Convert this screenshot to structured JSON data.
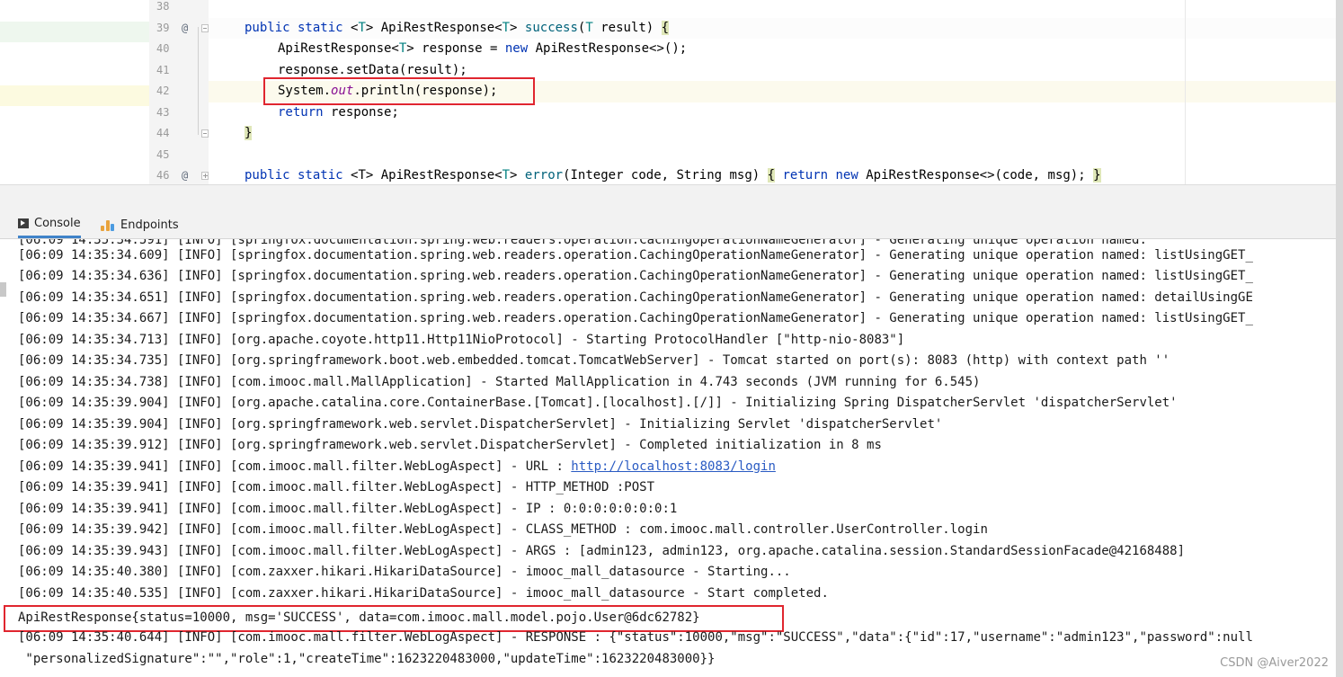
{
  "editor": {
    "lines": [
      {
        "num": "38",
        "ann": "",
        "fold": ""
      },
      {
        "num": "39",
        "ann": "@",
        "fold": "minus"
      },
      {
        "num": "40",
        "ann": "",
        "fold": ""
      },
      {
        "num": "41",
        "ann": "",
        "fold": ""
      },
      {
        "num": "42",
        "ann": "",
        "fold": ""
      },
      {
        "num": "43",
        "ann": "",
        "fold": ""
      },
      {
        "num": "44",
        "ann": "",
        "fold": "minus"
      },
      {
        "num": "45",
        "ann": "",
        "fold": ""
      },
      {
        "num": "46",
        "ann": "@",
        "fold": "plus"
      }
    ],
    "code": {
      "l39": {
        "a": "public static ",
        "b": "<",
        "c": "T",
        "d": "> ApiRestResponse<",
        "e": "T",
        "f": "> ",
        "g": "success",
        "h": "(",
        "i": "T",
        "j": " result) ",
        "k": "{"
      },
      "l40": {
        "a": "ApiRestResponse<",
        "b": "T",
        "c": "> response = ",
        "d": "new",
        "e": " ApiRestResponse<>();"
      },
      "l41": {
        "a": "response.setData(result);"
      },
      "l42": {
        "a": "System.",
        "b": "out",
        "c": ".println(response);"
      },
      "l43": {
        "a": "return",
        "b": " response;"
      },
      "l44": {
        "a": "}"
      },
      "l46": {
        "a": "public static ",
        "b": "<T>",
        "c": " ApiRestResponse<",
        "d": "T",
        "e": "> ",
        "f": "error",
        "g": "(Integer code, String msg) ",
        "h": "{",
        "i": " return new",
        "j": " ApiRestResponse<>(code, msg); ",
        "k": "}"
      }
    }
  },
  "toolwindow": {
    "tabs": [
      {
        "label": "Console",
        "icon": "console-icon"
      },
      {
        "label": "Endpoints",
        "icon": "endpoints-icon"
      }
    ]
  },
  "console": {
    "lines": [
      "[06:09 14:35:34.609] [INFO] [springfox.documentation.spring.web.readers.operation.CachingOperationNameGenerator] - Generating unique operation named: listUsingGET_",
      "[06:09 14:35:34.636] [INFO] [springfox.documentation.spring.web.readers.operation.CachingOperationNameGenerator] - Generating unique operation named: listUsingGET_",
      "[06:09 14:35:34.651] [INFO] [springfox.documentation.spring.web.readers.operation.CachingOperationNameGenerator] - Generating unique operation named: detailUsingGE",
      "[06:09 14:35:34.667] [INFO] [springfox.documentation.spring.web.readers.operation.CachingOperationNameGenerator] - Generating unique operation named: listUsingGET_",
      "[06:09 14:35:34.713] [INFO] [org.apache.coyote.http11.Http11NioProtocol] - Starting ProtocolHandler [\"http-nio-8083\"]",
      "[06:09 14:35:34.735] [INFO] [org.springframework.boot.web.embedded.tomcat.TomcatWebServer] - Tomcat started on port(s): 8083 (http) with context path ''",
      "[06:09 14:35:34.738] [INFO] [com.imooc.mall.MallApplication] - Started MallApplication in 4.743 seconds (JVM running for 6.545)",
      "[06:09 14:35:39.904] [INFO] [org.apache.catalina.core.ContainerBase.[Tomcat].[localhost].[/]] - Initializing Spring DispatcherServlet 'dispatcherServlet'",
      "[06:09 14:35:39.904] [INFO] [org.springframework.web.servlet.DispatcherServlet] - Initializing Servlet 'dispatcherServlet'",
      "[06:09 14:35:39.912] [INFO] [org.springframework.web.servlet.DispatcherServlet] - Completed initialization in 8 ms"
    ],
    "url_line": {
      "prefix": "[06:09 14:35:39.941] [INFO] [com.imooc.mall.filter.WebLogAspect] - URL : ",
      "link": "http://localhost:8083/login"
    },
    "lines2": [
      "[06:09 14:35:39.941] [INFO] [com.imooc.mall.filter.WebLogAspect] - HTTP_METHOD :POST",
      "[06:09 14:35:39.941] [INFO] [com.imooc.mall.filter.WebLogAspect] - IP : 0:0:0:0:0:0:0:1",
      "[06:09 14:35:39.942] [INFO] [com.imooc.mall.filter.WebLogAspect] - CLASS_METHOD : com.imooc.mall.controller.UserController.login",
      "[06:09 14:35:39.943] [INFO] [com.imooc.mall.filter.WebLogAspect] - ARGS : [admin123, admin123, org.apache.catalina.session.StandardSessionFacade@42168488]",
      "[06:09 14:35:40.380] [INFO] [com.zaxxer.hikari.HikariDataSource] - imooc_mall_datasource - Starting...",
      "[06:09 14:35:40.535] [INFO] [com.zaxxer.hikari.HikariDataSource] - imooc_mall_datasource - Start completed.",
      "ApiRestResponse{status=10000, msg='SUCCESS', data=com.imooc.mall.model.pojo.User@6dc62782}",
      "[06:09 14:35:40.644] [INFO] [com.imooc.mall.filter.WebLogAspect] - RESPONSE : {\"status\":10000,\"msg\":\"SUCCESS\",\"data\":{\"id\":17,\"username\":\"admin123\",\"password\":null",
      " \"personalizedSignature\":\"\",\"role\":1,\"createTime\":1623220483000,\"updateTime\":1623220483000}}"
    ]
  },
  "watermark": "CSDN @Aiver2022",
  "colors": {
    "highlight_box": "#e0262f",
    "keyword": "#0033b3",
    "link": "#2a5bc3"
  }
}
